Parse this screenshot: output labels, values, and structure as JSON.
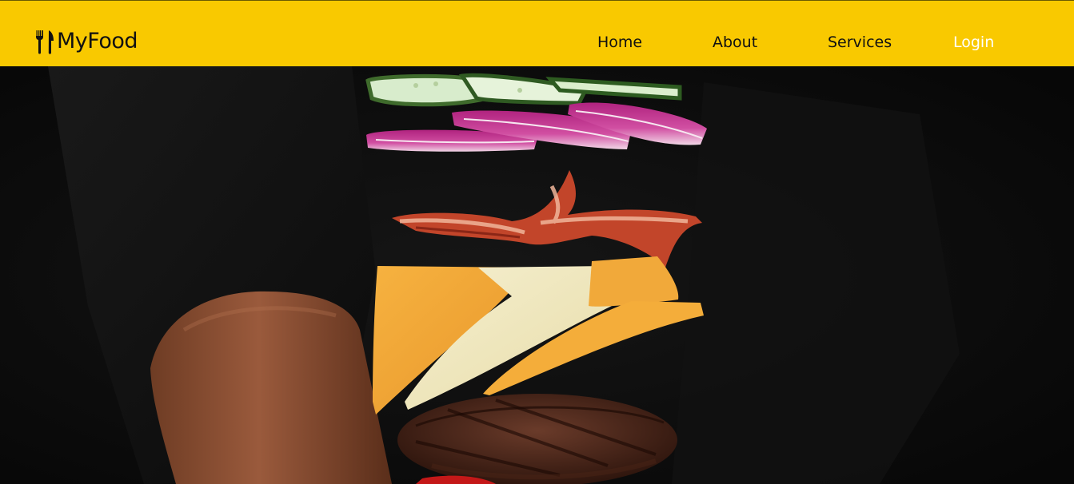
{
  "brand": {
    "name": "MyFood",
    "icon": "fork-knife-icon",
    "bar_color": "#f9c900"
  },
  "nav": {
    "home": "Home",
    "about": "About",
    "services": "Services",
    "login": "Login"
  },
  "hero": {
    "image": "floating-burger-ingredients-photo"
  }
}
